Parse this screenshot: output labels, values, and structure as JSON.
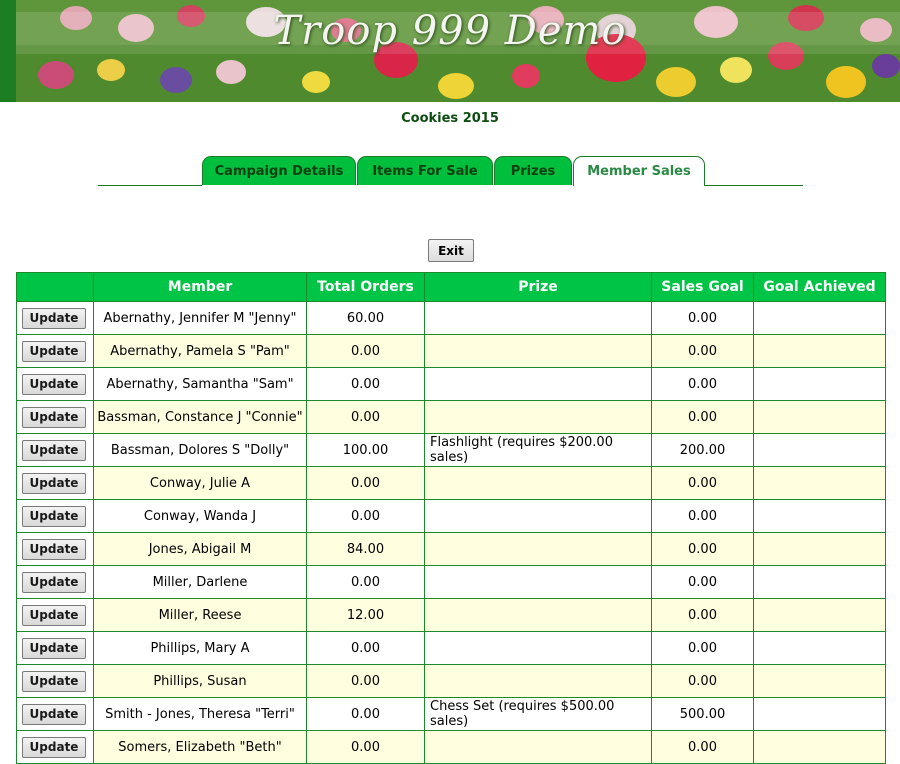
{
  "banner": {
    "title": "Troop 999 Demo"
  },
  "campaign": {
    "title": "Cookies 2015"
  },
  "tabs": [
    {
      "label": "Campaign Details",
      "active": false
    },
    {
      "label": "Items For Sale",
      "active": false
    },
    {
      "label": "Prizes",
      "active": false
    },
    {
      "label": "Member Sales",
      "active": true
    }
  ],
  "exit_label": "Exit",
  "update_label": "Update",
  "table": {
    "headers": [
      "",
      "Member",
      "Total Orders",
      "Prize",
      "Sales Goal",
      "Goal Achieved"
    ],
    "rows": [
      {
        "member": "Abernathy, Jennifer M \"Jenny\"",
        "total": "60.00",
        "prize": "",
        "goal": "0.00",
        "achieved": ""
      },
      {
        "member": "Abernathy, Pamela S \"Pam\"",
        "total": "0.00",
        "prize": "",
        "goal": "0.00",
        "achieved": ""
      },
      {
        "member": "Abernathy, Samantha \"Sam\"",
        "total": "0.00",
        "prize": "",
        "goal": "0.00",
        "achieved": ""
      },
      {
        "member": "Bassman, Constance J \"Connie\"",
        "total": "0.00",
        "prize": "",
        "goal": "0.00",
        "achieved": ""
      },
      {
        "member": "Bassman, Dolores S \"Dolly\"",
        "total": "100.00",
        "prize": "Flashlight (requires $200.00 sales)",
        "goal": "200.00",
        "achieved": ""
      },
      {
        "member": "Conway, Julie A",
        "total": "0.00",
        "prize": "",
        "goal": "0.00",
        "achieved": ""
      },
      {
        "member": "Conway, Wanda J",
        "total": "0.00",
        "prize": "",
        "goal": "0.00",
        "achieved": ""
      },
      {
        "member": "Jones, Abigail M",
        "total": "84.00",
        "prize": "",
        "goal": "0.00",
        "achieved": ""
      },
      {
        "member": "Miller, Darlene",
        "total": "0.00",
        "prize": "",
        "goal": "0.00",
        "achieved": ""
      },
      {
        "member": "Miller, Reese",
        "total": "12.00",
        "prize": "",
        "goal": "0.00",
        "achieved": ""
      },
      {
        "member": "Phillips, Mary A",
        "total": "0.00",
        "prize": "",
        "goal": "0.00",
        "achieved": ""
      },
      {
        "member": "Phillips, Susan",
        "total": "0.00",
        "prize": "",
        "goal": "0.00",
        "achieved": ""
      },
      {
        "member": "Smith - Jones, Theresa \"Terri\"",
        "total": "0.00",
        "prize": "Chess Set (requires $500.00 sales)",
        "goal": "500.00",
        "achieved": ""
      },
      {
        "member": "Somers, Elizabeth \"Beth\"",
        "total": "0.00",
        "prize": "",
        "goal": "0.00",
        "achieved": ""
      }
    ]
  },
  "colors": {
    "header_green": "#00c445",
    "tab_green": "#00bf3c",
    "row_alt": "#ffffe0",
    "dark_text": "#0b4d10"
  }
}
